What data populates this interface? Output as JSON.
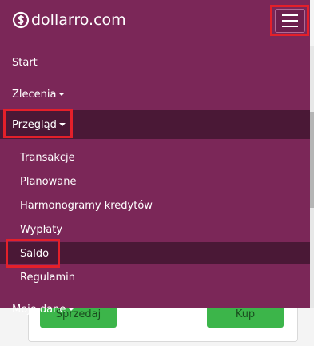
{
  "brand": {
    "name": "dollarro.com",
    "icon": "dollar-sign-icon"
  },
  "navbar": {
    "toggle_icon": "hamburger-menu-icon"
  },
  "menu": {
    "start": "Start",
    "zlecenia": "Zlecenia",
    "przeglad": "Przegląd",
    "sub_items": {
      "transakcje": "Transakcje",
      "planowane": "Planowane",
      "harmonogramy": "Harmonogramy kredytów",
      "wyplaty": "Wypłaty",
      "saldo": "Saldo",
      "regulamin": "Regulamin"
    },
    "moje_dane": "Moje dane"
  },
  "background": {
    "sell_label": "Sprzedaj",
    "buy_label": "Kup"
  },
  "colors": {
    "menu_bg": "#7b2758",
    "active_bg": "#4a1836",
    "highlight": "#e3202a",
    "action_green": "#3cb54a"
  }
}
